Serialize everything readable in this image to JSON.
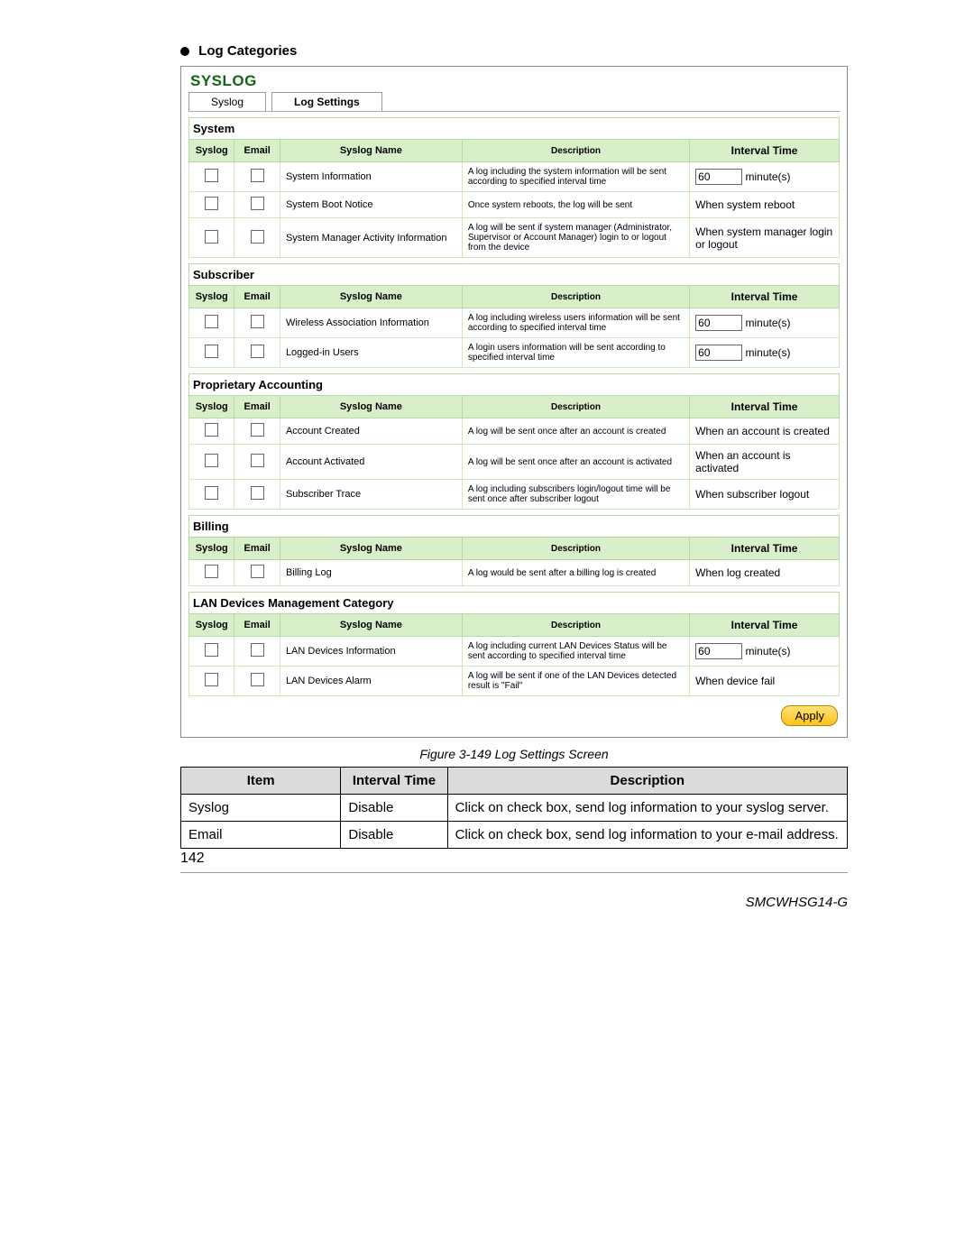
{
  "doc": {
    "bullet_title": "Log Categories",
    "panel_title": "SYSLOG",
    "tabs": {
      "syslog": "Syslog",
      "log_settings": "Log Settings"
    },
    "col": {
      "syslog": "Syslog",
      "email": "Email",
      "name": "Syslog Name",
      "desc": "Description",
      "interval": "Interval Time"
    },
    "minute_suffix": "minute(s)",
    "apply": "Apply",
    "caption": "Figure 3-149 Log Settings Screen",
    "page_num": "142",
    "model": "SMCWHSG14-G"
  },
  "sections": {
    "system": {
      "label": "System",
      "rows": [
        {
          "name": "System Information",
          "desc": "A log including the system information will be sent according to specified interval time",
          "interval_type": "input",
          "interval_value": "60"
        },
        {
          "name": "System Boot Notice",
          "desc": "Once system reboots, the log will be sent",
          "interval_type": "text",
          "interval_text": "When system reboot"
        },
        {
          "name": "System Manager Activity Information",
          "desc": "A log will be sent if system manager (Administrator, Supervisor or Account Manager) login to or logout from the device",
          "interval_type": "text",
          "interval_text": "When system manager login or logout"
        }
      ]
    },
    "subscriber": {
      "label": "Subscriber",
      "rows": [
        {
          "name": "Wireless Association Information",
          "desc": "A log including wireless users information will be sent according to specified interval time",
          "interval_type": "input",
          "interval_value": "60"
        },
        {
          "name": "Logged-in Users",
          "desc": "A login users information will be sent according to specified interval time",
          "interval_type": "input",
          "interval_value": "60"
        }
      ]
    },
    "accounting": {
      "label": "Proprietary Accounting",
      "rows": [
        {
          "name": "Account Created",
          "desc": "A log will be sent once after an account is created",
          "interval_type": "text",
          "interval_text": "When an account is created"
        },
        {
          "name": "Account Activated",
          "desc": "A log will be sent once after an account is activated",
          "interval_type": "text",
          "interval_text": "When an account is activated"
        },
        {
          "name": "Subscriber Trace",
          "desc": "A log including subscribers login/logout time will be sent once after subscriber logout",
          "interval_type": "text",
          "interval_text": "When subscriber logout"
        }
      ]
    },
    "billing": {
      "label": "Billing",
      "rows": [
        {
          "name": "Billing Log",
          "desc": "A log would be sent after a billing log is created",
          "interval_type": "text",
          "interval_text": "When log created"
        }
      ]
    },
    "lan": {
      "label": "LAN Devices Management Category",
      "rows": [
        {
          "name": "LAN Devices Information",
          "desc": "A log including current LAN Devices Status will be sent according to specified interval time",
          "interval_type": "input",
          "interval_value": "60"
        },
        {
          "name": "LAN Devices Alarm",
          "desc": "A log will be sent if one of the LAN Devices detected result is \"Fail\"",
          "interval_type": "text",
          "interval_text": "When device fail"
        }
      ]
    }
  },
  "desc_table": {
    "headers": {
      "item": "Item",
      "interval": "Interval Time",
      "desc": "Description"
    },
    "rows": [
      {
        "item": "Syslog",
        "interval": "Disable",
        "desc": "Click on check box, send log information to your syslog server."
      },
      {
        "item": "Email",
        "interval": "Disable",
        "desc": "Click on check box, send log information to your e-mail address."
      }
    ]
  }
}
